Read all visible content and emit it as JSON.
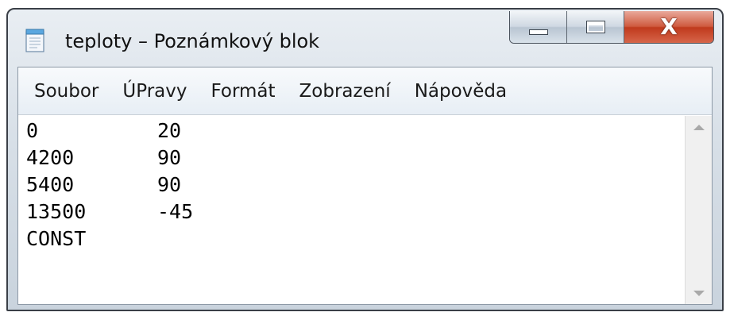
{
  "window": {
    "title": "teploty – Poznámkový blok",
    "app_icon": "notepad-icon",
    "buttons": {
      "minimize_icon": "minimize-icon",
      "maximize_icon": "maximize-icon",
      "close_icon": "close-icon",
      "close_glyph": "X"
    }
  },
  "menu": [
    "Soubor",
    "ÚPravy",
    "Formát",
    "Zobrazení",
    "Nápověda"
  ],
  "editor": {
    "lines": [
      {
        "a": "0",
        "b": "20"
      },
      {
        "a": "4200",
        "b": "90"
      },
      {
        "a": "5400",
        "b": "90"
      },
      {
        "a": "13500",
        "b": "-45"
      },
      {
        "a": "CONST",
        "b": ""
      }
    ]
  },
  "scrollbar": {
    "up_icon": "scroll-up-arrow-icon",
    "down_icon": "scroll-down-arrow-icon"
  },
  "colors": {
    "close_button": "#c8452a",
    "menubar_bg": "#eef3f8",
    "text": "#000000"
  }
}
